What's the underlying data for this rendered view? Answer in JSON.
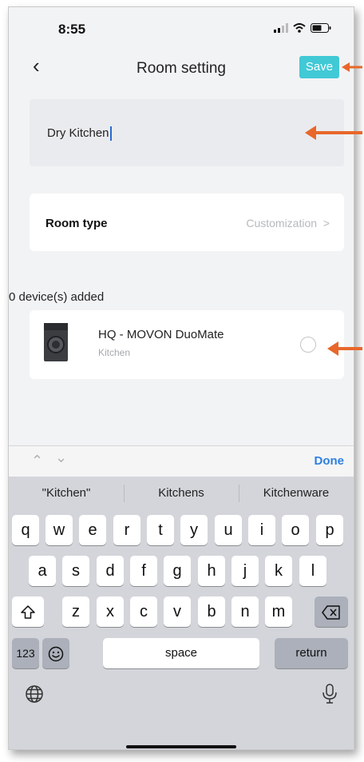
{
  "status": {
    "time": "8:55"
  },
  "nav": {
    "title": "Room setting",
    "save_label": "Save"
  },
  "room_name": {
    "value": "Dry Kitchen"
  },
  "room_type": {
    "label": "Room type",
    "value": "Customization",
    "chevron": ">"
  },
  "devices": {
    "count_label": "0 device(s) added",
    "items": [
      {
        "name": "HQ - MOVON DuoMate",
        "room": "Kitchen"
      }
    ]
  },
  "accessory_bar": {
    "done_label": "Done"
  },
  "keyboard": {
    "suggestions": [
      "\"Kitchen\"",
      "Kitchens",
      "Kitchenware"
    ],
    "row1": [
      "q",
      "w",
      "e",
      "r",
      "t",
      "y",
      "u",
      "i",
      "o",
      "p"
    ],
    "row2": [
      "a",
      "s",
      "d",
      "f",
      "g",
      "h",
      "j",
      "k",
      "l"
    ],
    "row3": [
      "z",
      "x",
      "c",
      "v",
      "b",
      "n",
      "m"
    ],
    "numbers_label": "123",
    "space_label": "space",
    "return_label": "return"
  },
  "colors": {
    "accent": "#41c9d6",
    "annotation": "#e8672a",
    "done": "#2d7fe0"
  }
}
